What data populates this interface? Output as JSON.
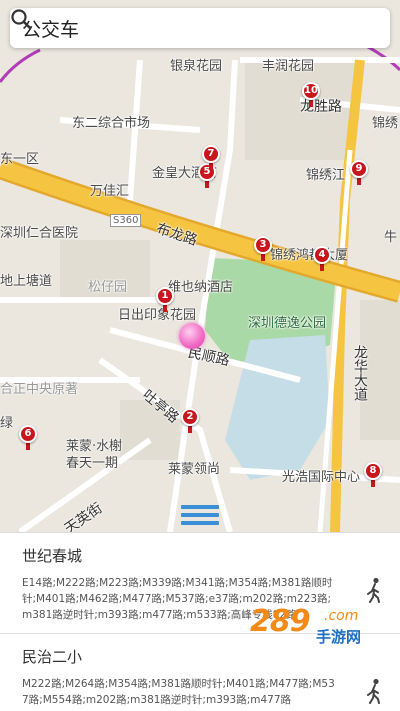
{
  "header": {
    "title": "公交车",
    "search_icon": "search-icon"
  },
  "map": {
    "labels": {
      "yinquan": "银泉花园",
      "fengrun": "丰润花园",
      "longsheng": "龙胜路",
      "jinxiu_top": "锦绣",
      "dong2market": "东二综合市场",
      "dong1": "东一区",
      "jinhuang": "金皇大酒店",
      "jinxiujiang": "锦绣江",
      "wanjiahui": "万佳汇",
      "renhe": "深圳仁合医院",
      "s360": "S360",
      "bulong": "布龙路",
      "jinxiuhong": "锦绣鸿都大厦",
      "niu": "牛",
      "shangtang": "地上塘道",
      "songziyuan": "松仔园",
      "weiyena": "维也纳酒店",
      "richu": "日出印象花园",
      "deyi_park": "深圳德逸公园",
      "minshun": "民顺路",
      "longhua": "龙华大道",
      "hezheng": "合正中央原著",
      "shufeng": "吐亭路",
      "lv": "绿",
      "laimeng_shuixie": "莱蒙·水榭春天一期",
      "laimeng_lingshang": "莱蒙领尚",
      "guangxin": "光浩国际中心",
      "tianying": "天英街"
    },
    "markers": [
      "1",
      "2",
      "3",
      "4",
      "5",
      "6",
      "7",
      "8",
      "9",
      "10"
    ],
    "accent_color": "#c8161d",
    "road_color": "#f5c542",
    "park_color": "#a9d9a6",
    "boundary_color": "#b03cb6"
  },
  "menu_button_icon": "list-icon",
  "results": [
    {
      "name": "世纪春城",
      "routes": "E14路;M222路;M223路;M339路;M341路;M354路;M381路顺时针;M401路;M462路;M477路;M537路;e37路;m202路;m223路;m381路逆时针;m393路;m477路;m533路;高峰专线92路",
      "icon": "walk-icon"
    },
    {
      "name": "民治二小",
      "routes": "M222路;M264路;M354路;M381路顺时针;M401路;M477路;M537路;M554路;m202路;m381路逆时针;m393路;m477路",
      "icon": "walk-icon"
    }
  ],
  "watermark": {
    "number": "289",
    "domain": ".com",
    "sub": "手游网"
  }
}
